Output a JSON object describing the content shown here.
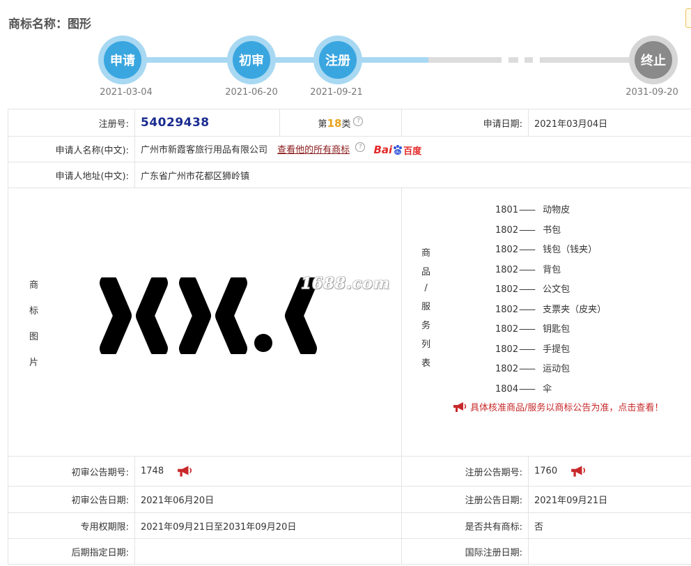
{
  "title": "商标名称：图形",
  "timeline": {
    "steps": [
      {
        "label": "申请",
        "date": "2021-03-04"
      },
      {
        "label": "初审",
        "date": "2021-06-20"
      },
      {
        "label": "注册",
        "date": "2021-09-21"
      },
      {
        "label": "终止",
        "date": "2031-09-20"
      }
    ]
  },
  "table": {
    "reg_no_label": "注册号:",
    "reg_no": "54029438",
    "class_prefix": "第",
    "class_num": "18",
    "class_suffix": "类",
    "help_icon": "?",
    "apply_date_label": "申请日期:",
    "apply_date": "2021年03月04日",
    "applicant_label": "申请人名称(中文):",
    "applicant": "广州市新霞客旅行用品有限公司",
    "all_marks_link": "查看他的所有商标",
    "baidu_brand": "Bai",
    "baidu_cn": "百度",
    "address_label": "申请人地址(中文):",
    "address": "广东省广州市花都区狮岭镇",
    "image_label": [
      "商",
      "标",
      "图",
      "片"
    ],
    "watermark": "1688.com",
    "goods_label": [
      "商",
      "品",
      "/",
      "服",
      "务",
      "列",
      "表"
    ],
    "goods_dash": "——",
    "goods": [
      {
        "code": "1801",
        "name": "动物皮"
      },
      {
        "code": "1802",
        "name": "书包"
      },
      {
        "code": "1802",
        "name": "钱包（钱夹）"
      },
      {
        "code": "1802",
        "name": "背包"
      },
      {
        "code": "1802",
        "name": "公文包"
      },
      {
        "code": "1802",
        "name": "支票夹（皮夹）"
      },
      {
        "code": "1802",
        "name": "钥匙包"
      },
      {
        "code": "1802",
        "name": "手提包"
      },
      {
        "code": "1802",
        "name": "运动包"
      },
      {
        "code": "1804",
        "name": "伞"
      }
    ],
    "goods_note": "具体核准商品/服务以商标公告为准，点击查看！",
    "prelim_issue_label": "初审公告期号:",
    "prelim_issue": "1748",
    "reg_issue_label": "注册公告期号:",
    "reg_issue": "1760",
    "prelim_date_label": "初审公告日期:",
    "prelim_date": "2021年06月20日",
    "reg_date_label": "注册公告日期:",
    "reg_date": "2021年09月21日",
    "exclusive_label": "专用权期限:",
    "exclusive": "2021年09月21日至2031年09月20日",
    "shared_label": "是否共有商标:",
    "shared": "否",
    "later_date_label": "后期指定日期:",
    "later_date": "",
    "intl_date_label": "国际注册日期:",
    "intl_date": ""
  },
  "colors": {
    "timeline_active": "#3aa6e0",
    "timeline_inactive": "#8a8a8a",
    "reg_no": "#1a2c8f",
    "class_num": "#e8a319",
    "note": "#c8282a"
  }
}
